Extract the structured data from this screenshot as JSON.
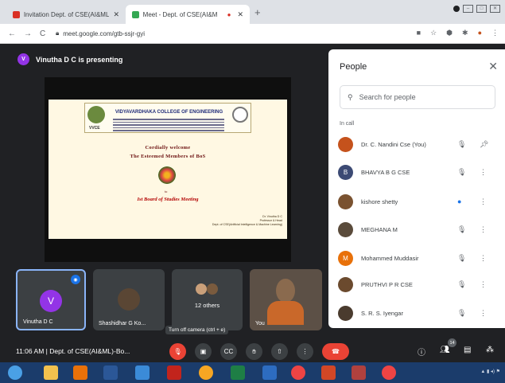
{
  "browser": {
    "tabs": [
      {
        "label": "Invitation Dept. of CSE(AI&ML)",
        "color": "#d93025"
      },
      {
        "label": "Meet - Dept. of CSE(AI&M",
        "color": "#34a853"
      }
    ],
    "url": "meet.google.com/gtb-ssjr-gyi"
  },
  "presentation": {
    "presenting_label": "Vinutha D C is presenting",
    "presenter_initial": "V",
    "slide": {
      "college": "VIDYAVARDHAKA COLLEGE OF ENGINEERING",
      "college_short": "VVCE",
      "line1": "Cordially welcome",
      "line2": "The Esteemed Members of BoS",
      "to": "to",
      "meeting": "Ist Board of Studies Meeting",
      "signature": "Dr. Vinutha D C\nProfessor & Head\nDept. of CSE(Artificial Intelligence & Machine Learning)"
    }
  },
  "tiles": [
    {
      "name": "Vinutha D C",
      "initial": "V"
    },
    {
      "name": "Shashidhar G Ko..."
    },
    {
      "name": "12 others",
      "label": "12 others"
    },
    {
      "name": "You"
    }
  ],
  "people_panel": {
    "title": "People",
    "search_placeholder": "Search for people",
    "section": "In call",
    "participants": [
      {
        "name": "Dr. C. Nandini Cse (You)",
        "initial": "",
        "color": "#c5521c"
      },
      {
        "name": "BHAVYA B G CSE",
        "initial": "B",
        "color": "#3c4a74"
      },
      {
        "name": "kishore shetty",
        "initial": "",
        "color": "#7a5230"
      },
      {
        "name": "MEGHANA M",
        "initial": "",
        "color": "#5a4b3b"
      },
      {
        "name": "Mohammed Muddasir",
        "initial": "M",
        "color": "#e8710a"
      },
      {
        "name": "PRUTHVI P R CSE",
        "initial": "",
        "color": "#6b4a2e"
      },
      {
        "name": "S. R. S. Iyengar",
        "initial": "",
        "color": "#4a3b2e"
      }
    ]
  },
  "tooltip": "Turn off camera (ctrl + e)",
  "controls": {
    "time_meeting": "11:06 AM  |  Dept. of CSE(AI&ML)-Bo...",
    "participant_count": "14"
  },
  "colors": {
    "accent": "#1a73e8",
    "end_call": "#ea4335",
    "stage": "#202124"
  }
}
